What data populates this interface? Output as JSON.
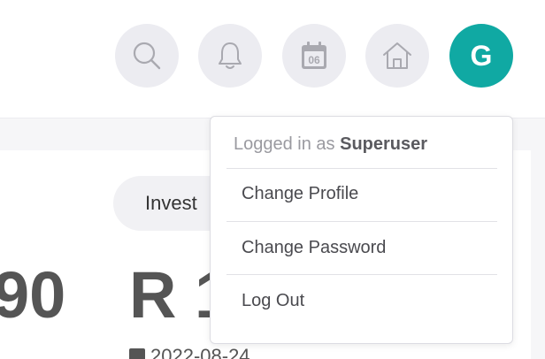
{
  "header": {
    "icons": [
      "search-icon",
      "bell-icon",
      "calendar-icon",
      "home-icon"
    ],
    "calendar_day": "06",
    "avatar_initial": "G",
    "avatar_color": "#10a9a3"
  },
  "content": {
    "pill_label": "Invest",
    "big_left": "90",
    "big_right": "R 1",
    "date": "2022-08-24"
  },
  "dropdown": {
    "logged_in_prefix": "Logged in as",
    "username": "Superuser",
    "items": [
      {
        "label": "Change Profile"
      },
      {
        "label": "Change Password"
      },
      {
        "label": "Log Out"
      }
    ]
  }
}
